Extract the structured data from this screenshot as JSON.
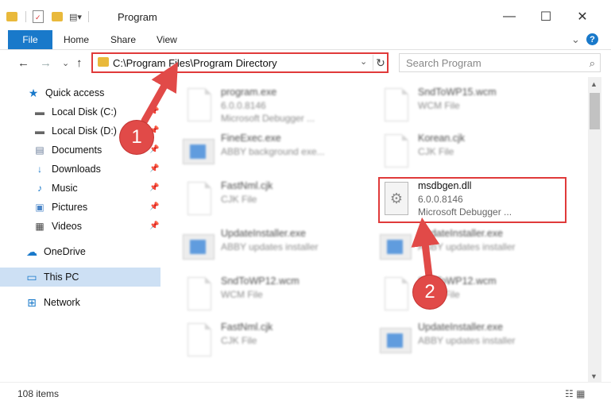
{
  "window": {
    "title": "Program",
    "controls": {
      "minimize": "—",
      "maximize": "☐",
      "close": "✕"
    }
  },
  "ribbon": {
    "file": "File",
    "tabs": [
      "Home",
      "Share",
      "View"
    ],
    "expand": "⌄",
    "help": "?"
  },
  "nav": {
    "back": "←",
    "forward": "→",
    "recent": "⌄",
    "up": "↑",
    "address": "C:\\Program Files\\Program Directory",
    "address_dropdown": "⌄",
    "refresh": "↻",
    "search_placeholder": "Search Program",
    "search_icon": "⌕"
  },
  "sidebar": {
    "items": [
      {
        "label": "Quick access",
        "icon": "star-icon",
        "glyph": "★",
        "pinned": false,
        "selected": false
      },
      {
        "label": "Local Disk (C:)",
        "icon": "drive-icon",
        "glyph": "▬",
        "pinned": true,
        "selected": false
      },
      {
        "label": "Local Disk (D:)",
        "icon": "drive-icon",
        "glyph": "▬",
        "pinned": true,
        "selected": false
      },
      {
        "label": "Documents",
        "icon": "documents-icon",
        "glyph": "▤",
        "pinned": true,
        "selected": false
      },
      {
        "label": "Downloads",
        "icon": "downloads-icon",
        "glyph": "↓",
        "pinned": true,
        "selected": false
      },
      {
        "label": "Music",
        "icon": "music-icon",
        "glyph": "♪",
        "pinned": true,
        "selected": false
      },
      {
        "label": "Pictures",
        "icon": "pictures-icon",
        "glyph": "▣",
        "pinned": true,
        "selected": false
      },
      {
        "label": "Videos",
        "icon": "videos-icon",
        "glyph": "▦",
        "pinned": true,
        "selected": false
      },
      {
        "label": "OneDrive",
        "icon": "onedrive-icon",
        "glyph": "☁",
        "pinned": false,
        "selected": false
      },
      {
        "label": "This PC",
        "icon": "computer-icon",
        "glyph": "▭",
        "pinned": false,
        "selected": true
      },
      {
        "label": "Network",
        "icon": "network-icon",
        "glyph": "⊞",
        "pinned": false,
        "selected": false
      }
    ]
  },
  "files": [
    {
      "name": "program.exe",
      "line2": "6.0.0.8146",
      "line3": "Microsoft Debugger ...",
      "icon": "exe-icon"
    },
    {
      "name": "SndToWP15.wcm",
      "line2": "WCM File",
      "line3": "",
      "icon": "document-icon"
    },
    {
      "name": "FineExec.exe",
      "line2": "ABBY background exe...",
      "line3": "",
      "icon": "app-icon"
    },
    {
      "name": "Korean.cjk",
      "line2": "CJK File",
      "line3": "",
      "icon": "document-icon"
    },
    {
      "name": "FastNml.cjk",
      "line2": "CJK File",
      "line3": "",
      "icon": "document-icon"
    },
    {
      "name": "msdbgen.dll",
      "line2": "6.0.0.8146",
      "line3": "Microsoft Debugger ...",
      "icon": "dll-gear-icon"
    },
    {
      "name": "UpdateInstaller.exe",
      "line2": "ABBY updates installer",
      "line3": "",
      "icon": "app-icon"
    },
    {
      "name": "UpdateInstaller.exe",
      "line2": "ABBY updates installer",
      "line3": "",
      "icon": "app-icon"
    },
    {
      "name": "SndToWP12.wcm",
      "line2": "WCM File",
      "line3": "",
      "icon": "document-icon"
    },
    {
      "name": "SndToWP12.wcm",
      "line2": "WCM File",
      "line3": "",
      "icon": "document-icon"
    },
    {
      "name": "FastNml.cjk",
      "line2": "CJK File",
      "line3": "",
      "icon": "document-icon"
    },
    {
      "name": "UpdateInstaller.exe",
      "line2": "ABBY updates installer",
      "line3": "",
      "icon": "app-icon"
    }
  ],
  "status": {
    "item_count": "108 items",
    "view_icons": "☷ ▦"
  },
  "annotations": {
    "step1": "1",
    "step2": "2",
    "color": "#e14a48"
  }
}
